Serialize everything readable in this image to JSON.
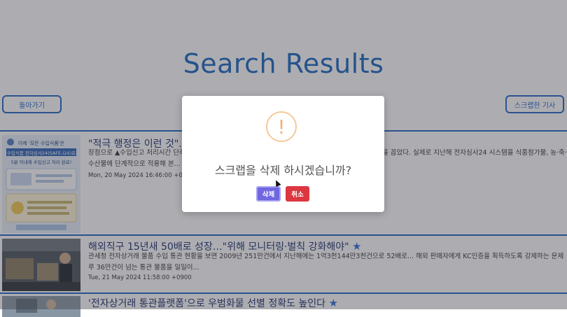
{
  "page": {
    "title": "Search Results"
  },
  "toolbar": {
    "back_label": "돌아가기",
    "scrapped_label": "스크랩한 기사"
  },
  "results": [
    {
      "title": "\"적극 행정은 이런 것\"…",
      "desc_left": "장점으로 ▲수입신고 처리시간 단축",
      "desc_right": "을 꼽았다. 실제로 지난해 전자심사24 시스템을 식품첨가물, 농·축·",
      "desc_line2": "수산물에 단계적으로 적용해 본...",
      "date": "Mon, 20 May 2024 16:46:00 +0900",
      "thumb": {
        "headline_1": "이제 '모든 수입식품'은",
        "headline_2": "수입식품 전자심사24(SAFE-i24)로",
        "headline_3": "5분 이내에 수입신고 처리 완료!"
      }
    },
    {
      "title": "해외직구 15년새 50배로 성장…\"위해 모니터링·벌칙 강화해야\"",
      "star": "★",
      "desc_line1": "관세청 전자상거래 물품 수입 통관 현황을 보면 2009년 251만건에서 지난해에는 1억3천144만3천건으로 52배로... 해외 판매자에게 KC인증을 획득하도록 강제하는 문제는 제척두고 하",
      "desc_line2": "루 36만건이 넘는 통관 물품을 일일이...",
      "date": "Tue, 21 May 2024 11:58:00 +0900"
    },
    {
      "title": "'전자상거래 통관플랫폼'으로 우범화물 선별 정확도 높인다",
      "star": "★"
    }
  ],
  "modal": {
    "icon": "!",
    "message": "스크랩을 삭제 하시겠습니까?",
    "confirm_label": "삭제",
    "cancel_label": "취소"
  },
  "colors": {
    "accent": "#1e63c4",
    "confirm": "#7066e0",
    "cancel": "#dc3741",
    "warning": "#f4b27b"
  }
}
